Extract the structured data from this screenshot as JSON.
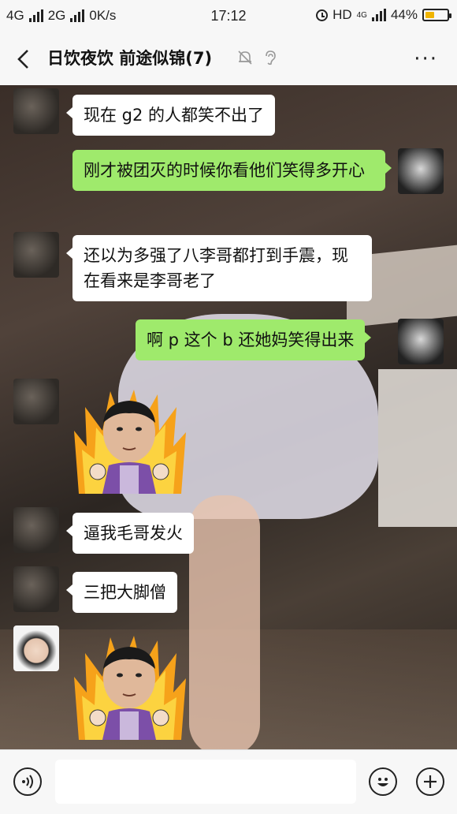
{
  "status_bar": {
    "net1": "4G",
    "net2": "2G",
    "speed": "0K/s",
    "time": "17:12",
    "hd": "HD",
    "net3": "4G",
    "battery": "44%",
    "battery_level": 0.44,
    "battery_color": "#f0b400"
  },
  "header": {
    "title": "日饮夜饮 前途似锦(7)",
    "more": "···",
    "icons": [
      "back-arrow-icon",
      "mute-bell-icon",
      "ear-icon",
      "more-icon"
    ]
  },
  "messages": [
    {
      "side": "left",
      "avatar": "avatar-dark",
      "text": "现在 g2 的人都笑不出了"
    },
    {
      "side": "right",
      "avatar": "avatar-anime",
      "text": "刚才被团灭的时候你看他们笑得多开心"
    },
    {
      "side": "left",
      "avatar": "avatar-dark",
      "text": "还以为多强了八李哥都打到手震，现在看来是李哥老了"
    },
    {
      "side": "right",
      "avatar": "avatar-anime",
      "text": "啊 p 这个 b 还她妈笑得出来"
    },
    {
      "side": "left",
      "avatar": "avatar-dark",
      "sticker": "angry-fire-face-sticker"
    },
    {
      "side": "left",
      "avatar": "avatar-dark",
      "text": "逼我毛哥发火"
    },
    {
      "side": "left",
      "avatar": "avatar-dark",
      "text": "三把大脚僧"
    },
    {
      "side": "left",
      "avatar": "avatar-boy",
      "sticker": "angry-fire-face-sticker"
    }
  ],
  "colors": {
    "green_bubble": "#9fea6c",
    "white_bubble": "#ffffff"
  },
  "input_bar": {
    "icons": [
      "voice-icon",
      "emoji-icon",
      "plus-icon"
    ],
    "value": ""
  }
}
